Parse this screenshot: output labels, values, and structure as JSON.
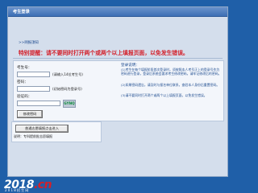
{
  "window": {
    "title": "考生登录"
  },
  "breadcrumb": ">>网报须知",
  "warning": "特别提醒：请不要同时打开两个或两个以上填报页面，以免发生错误。",
  "login": {
    "exam_no_label": "考生号：",
    "exam_no_hint": "(请输入14位考生号)",
    "password_label": "密码：",
    "password_hint": "(初始密码为登录号)",
    "captcha_label": "验证码：",
    "captcha_value": "GYNQ",
    "change_password_button": "修改密码"
  },
  "notes": {
    "title": "登录说明：",
    "items": [
      "(1)考生在每个填报阶段首次登录时，须按照本人考号正上的登录号作为密码进行登录，登录后系统会要求考生修改密码，请牢记修改后的密码。",
      "(2)如果密码遗忘，请及时与报名单位联系，查验本人身份后重置密码。",
      "(3)请不要同时打开两个或两个以上填报页面，以免发生错误。"
    ]
  },
  "notice": {
    "button": "普通志愿填报点击进入",
    "text": "说明：专科提前批志愿填报"
  },
  "brand": {
    "logo_main": "2018",
    "logo_suffix": ".cn",
    "logo_sub": "2018招生网"
  }
}
